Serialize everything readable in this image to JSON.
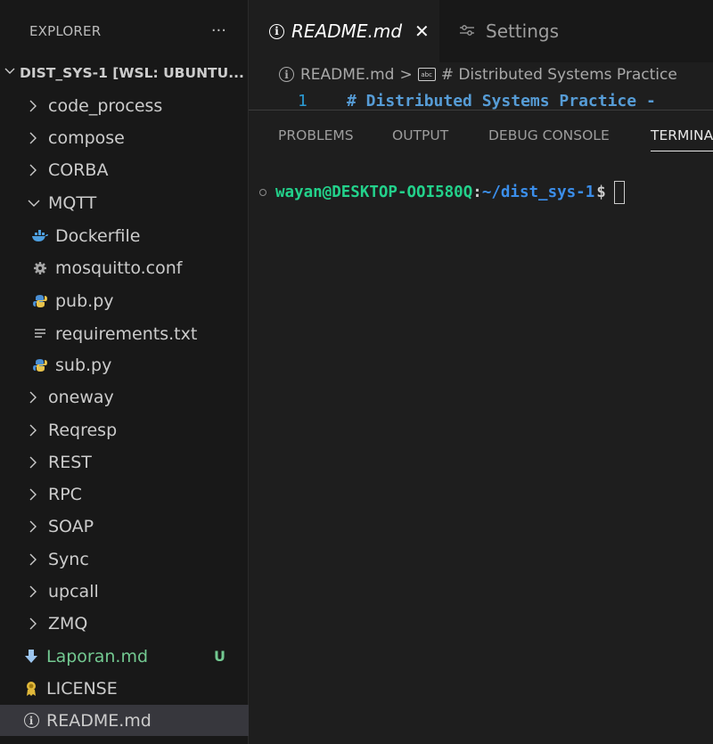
{
  "sidebar": {
    "title": "EXPLORER",
    "more_label": "···",
    "root_folder": "DIST_SYS-1 [WSL: UBUNTU...",
    "items": [
      {
        "label": "code_process",
        "type": "folder",
        "expanded": false
      },
      {
        "label": "compose",
        "type": "folder",
        "expanded": false
      },
      {
        "label": "CORBA",
        "type": "folder",
        "expanded": false
      },
      {
        "label": "MQTT",
        "type": "folder",
        "expanded": true
      },
      {
        "label": "Dockerfile",
        "type": "file",
        "icon": "docker-icon"
      },
      {
        "label": "mosquitto.conf",
        "type": "file",
        "icon": "gear-icon"
      },
      {
        "label": "pub.py",
        "type": "file",
        "icon": "python-icon"
      },
      {
        "label": "requirements.txt",
        "type": "file",
        "icon": "lines-icon"
      },
      {
        "label": "sub.py",
        "type": "file",
        "icon": "python-icon"
      },
      {
        "label": "oneway",
        "type": "folder",
        "expanded": false
      },
      {
        "label": "Reqresp",
        "type": "folder",
        "expanded": false
      },
      {
        "label": "REST",
        "type": "folder",
        "expanded": false
      },
      {
        "label": "RPC",
        "type": "folder",
        "expanded": false
      },
      {
        "label": "SOAP",
        "type": "folder",
        "expanded": false
      },
      {
        "label": "Sync",
        "type": "folder",
        "expanded": false
      },
      {
        "label": "upcall",
        "type": "folder",
        "expanded": false
      },
      {
        "label": "ZMQ",
        "type": "folder",
        "expanded": false
      },
      {
        "label": "Laporan.md",
        "type": "file",
        "icon": "download-arrow-icon",
        "badge": "U"
      },
      {
        "label": "LICENSE",
        "type": "file",
        "icon": "license-icon"
      },
      {
        "label": "README.md",
        "type": "file",
        "icon": "info-icon",
        "selected": true
      }
    ]
  },
  "tabs": {
    "readme": {
      "label": "README.md",
      "close": "✕"
    },
    "settings": {
      "label": "Settings"
    }
  },
  "breadcrumb": {
    "file": "README.md",
    "separator": ">",
    "symbol_icon_text": "abc",
    "symbol": "# Distributed Systems Practice"
  },
  "editor": {
    "line_number": "1",
    "line_content": "# Distributed Systems Practice - "
  },
  "panel": {
    "tabs": [
      "PROBLEMS",
      "OUTPUT",
      "DEBUG CONSOLE",
      "TERMINAL"
    ],
    "active_tab": "TERMINAL"
  },
  "terminal": {
    "user_host": "wayan@DESKTOP-OOI580Q",
    "colon": ":",
    "path": "~/dist_sys-1",
    "dollar": "$"
  },
  "colors": {
    "git_untracked": "#73c991",
    "prompt_user": "#23d18b",
    "prompt_path": "#3b8eea",
    "selection_bg": "#37373d"
  }
}
